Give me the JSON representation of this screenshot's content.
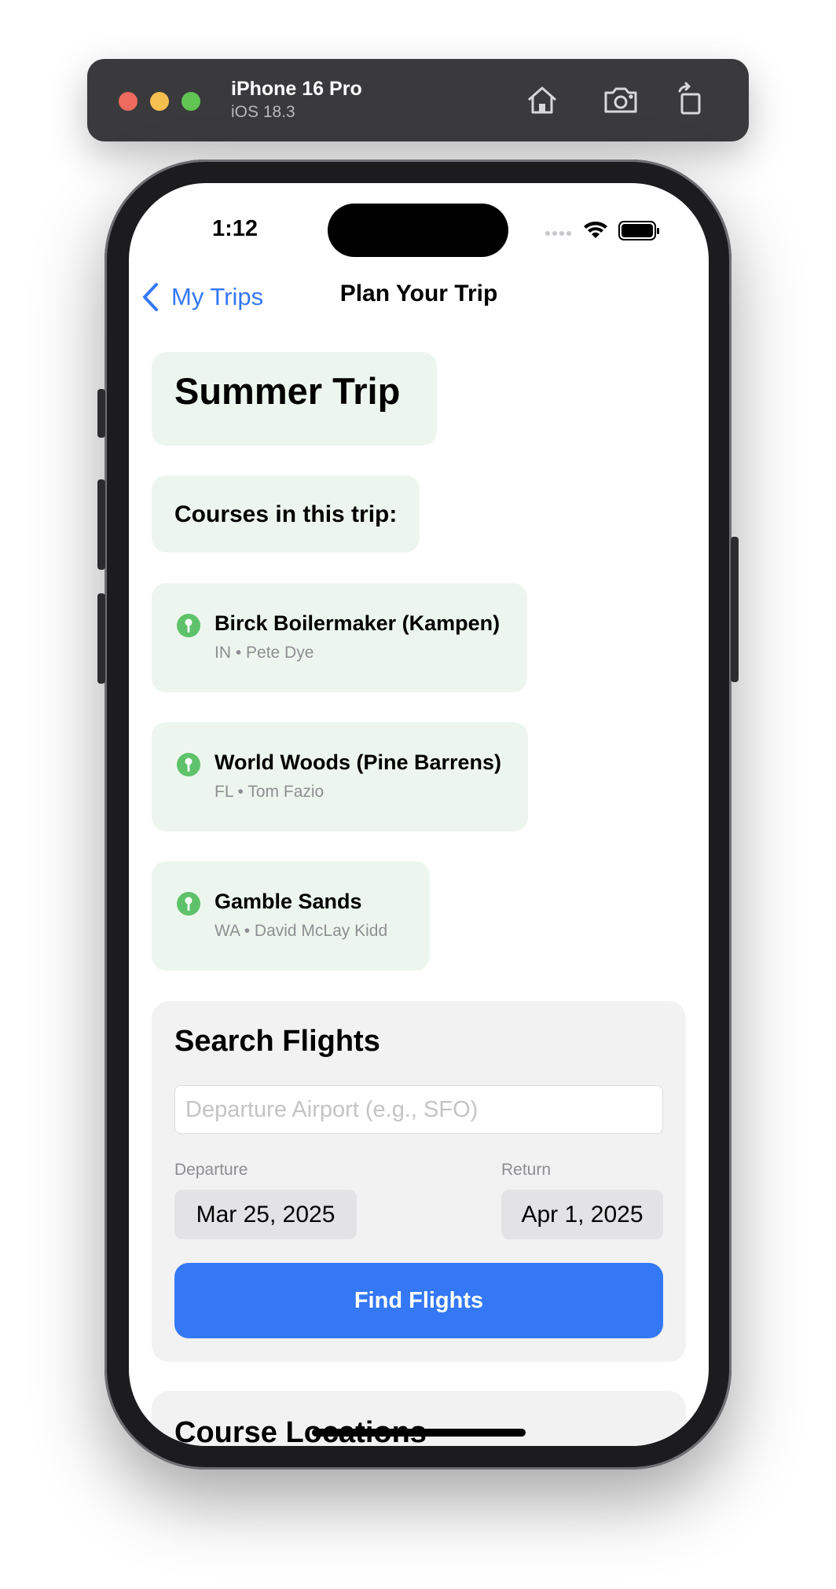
{
  "simulator": {
    "device_name": "iPhone 16 Pro",
    "os_version": "iOS 18.3",
    "toolbar_icons": [
      "home-icon",
      "screenshot-icon",
      "rotate-icon"
    ]
  },
  "status_bar": {
    "time": "1:12",
    "icons": [
      "cellular-icon",
      "wifi-icon",
      "battery-icon"
    ]
  },
  "nav": {
    "back_label": "My Trips",
    "title": "Plan Your Trip"
  },
  "trip": {
    "title": "Summer Trip",
    "courses_label": "Courses in this trip:",
    "courses": [
      {
        "name": "Birck Boilermaker (Kampen)",
        "meta": "IN • Pete Dye"
      },
      {
        "name": "World Woods (Pine Barrens)",
        "meta": "FL • Tom Fazio"
      },
      {
        "name": "Gamble Sands",
        "meta": "WA • David McLay Kidd"
      }
    ]
  },
  "flights": {
    "heading": "Search Flights",
    "airport_placeholder": "Departure Airport (e.g., SFO)",
    "airport_value": "",
    "departure_label": "Departure",
    "departure_date": "Mar 25, 2025",
    "return_label": "Return",
    "return_date": "Apr 1, 2025",
    "button_label": "Find Flights"
  },
  "locations": {
    "heading": "Course Locations"
  },
  "colors": {
    "accent": "#3478f6",
    "card_green": "#edf6ee",
    "pin_green": "#5ec26a",
    "card_gray": "#f2f2f2"
  }
}
